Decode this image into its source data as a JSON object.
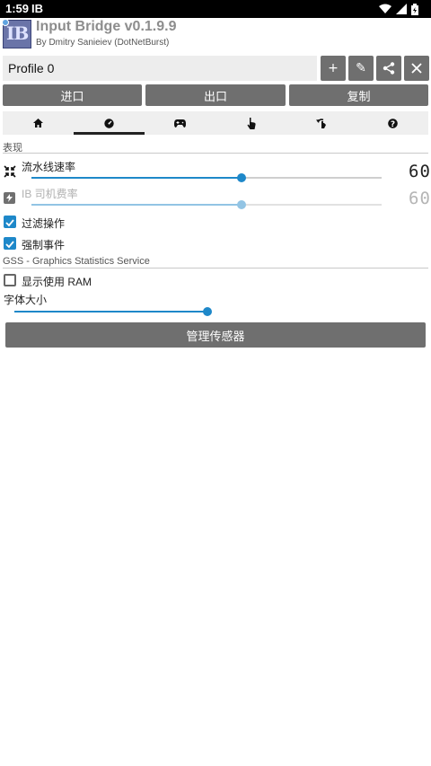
{
  "status_bar": {
    "time": "1:59",
    "app_indicator": "IB"
  },
  "header": {
    "logo_text": "IB",
    "title": "Input Bridge v0.1.9.9",
    "subtitle": "By Dmitry Sanieiev (DotNetBurst)"
  },
  "profile": {
    "name": "Profile 0",
    "add_label": "+",
    "edit_label": "✎"
  },
  "main_buttons": {
    "import": "进口",
    "export": "出口",
    "copy": "复制"
  },
  "tabs": [
    {
      "icon": "home-icon"
    },
    {
      "icon": "speedometer-icon",
      "selected": true
    },
    {
      "icon": "gamepad-icon"
    },
    {
      "icon": "touch-icon"
    },
    {
      "icon": "rotate-icon"
    },
    {
      "icon": "help-icon"
    }
  ],
  "performance": {
    "section_label": "表现",
    "pipeline_rate": {
      "label": "流水线速率",
      "value": "60",
      "level_fraction": 0.6
    },
    "ib_driver_rate": {
      "label": "IB 司机费率",
      "value": "60",
      "level_fraction": 0.6,
      "disabled": true
    },
    "filter_ops": {
      "label": "过滤操作",
      "checked": true
    },
    "force_events": {
      "label": "强制事件",
      "checked": true
    }
  },
  "gss": {
    "section_label": "GSS - Graphics Statistics Service",
    "show_ram": {
      "label": "显示使用 RAM",
      "checked": false
    },
    "font_size": {
      "label": "字体大小",
      "level_fraction": 0.5
    },
    "manage_sensors": "管理传感器"
  },
  "colors": {
    "accent": "#1e88c9",
    "button": "#6f6f6f",
    "input_bg": "#ededed"
  }
}
